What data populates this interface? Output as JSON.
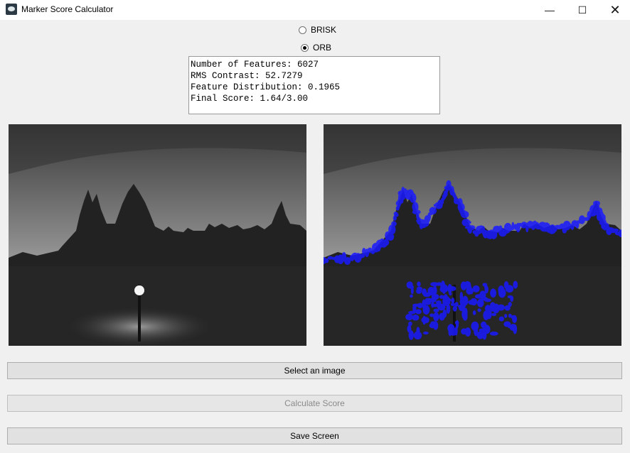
{
  "window": {
    "title": "Marker Score Calculator",
    "icons": [
      "app-icon",
      "minimize-icon",
      "maximize-icon",
      "close-icon"
    ]
  },
  "detector": {
    "options": [
      {
        "label": "BRISK",
        "checked": false
      },
      {
        "label": "ORB",
        "checked": true
      }
    ]
  },
  "results": {
    "lines": [
      "Number of Features: 6027",
      "RMS Contrast: 52.7279",
      "Feature Distribution: 0.1965",
      "Final Score: 1.64/3.00"
    ]
  },
  "images": {
    "left": "original grayscale image of gothic building at dusk with street lamp",
    "right": "same image with detected ORB features overlaid in blue",
    "feature_color": "#1a1aff"
  },
  "buttons": {
    "select": {
      "label": "Select an image",
      "enabled": true
    },
    "calculate": {
      "label": "Calculate Score",
      "enabled": false
    },
    "save": {
      "label": "Save Screen",
      "enabled": true
    }
  }
}
